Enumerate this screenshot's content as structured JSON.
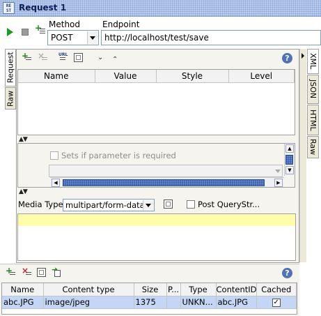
{
  "window": {
    "icon_text": "RE\nST",
    "title": "Request 1"
  },
  "toolbar": {
    "method_label": "Method",
    "endpoint_label": "Endpoint"
  },
  "method": {
    "selected": "POST"
  },
  "endpoint": {
    "value": "http://localhost/test/save"
  },
  "left_tabs": [
    {
      "label": "Request",
      "active": true
    },
    {
      "label": "Raw",
      "active": false
    }
  ],
  "right_tabs": [
    {
      "label": "XML"
    },
    {
      "label": "JSON"
    },
    {
      "label": "HTML"
    },
    {
      "label": "Raw"
    }
  ],
  "params": {
    "columns": [
      "Name",
      "Value",
      "Style",
      "Level"
    ],
    "required_label": "Sets if parameter is required",
    "help": "?"
  },
  "media": {
    "label": "Media Type",
    "selected": "multipart/form-data",
    "post_query_label": "Post QueryStr..."
  },
  "attachments": {
    "help": "?",
    "columns": [
      "Name",
      "Content type",
      "Size",
      "P...",
      "Type",
      "ContentID",
      "Cached"
    ],
    "rows": [
      {
        "name": "abc.JPG",
        "content_type": "image/jpeg",
        "size": "1375",
        "p": "",
        "type": "UNKN...",
        "content_id": "abc.JPG",
        "cached": true
      }
    ]
  }
}
